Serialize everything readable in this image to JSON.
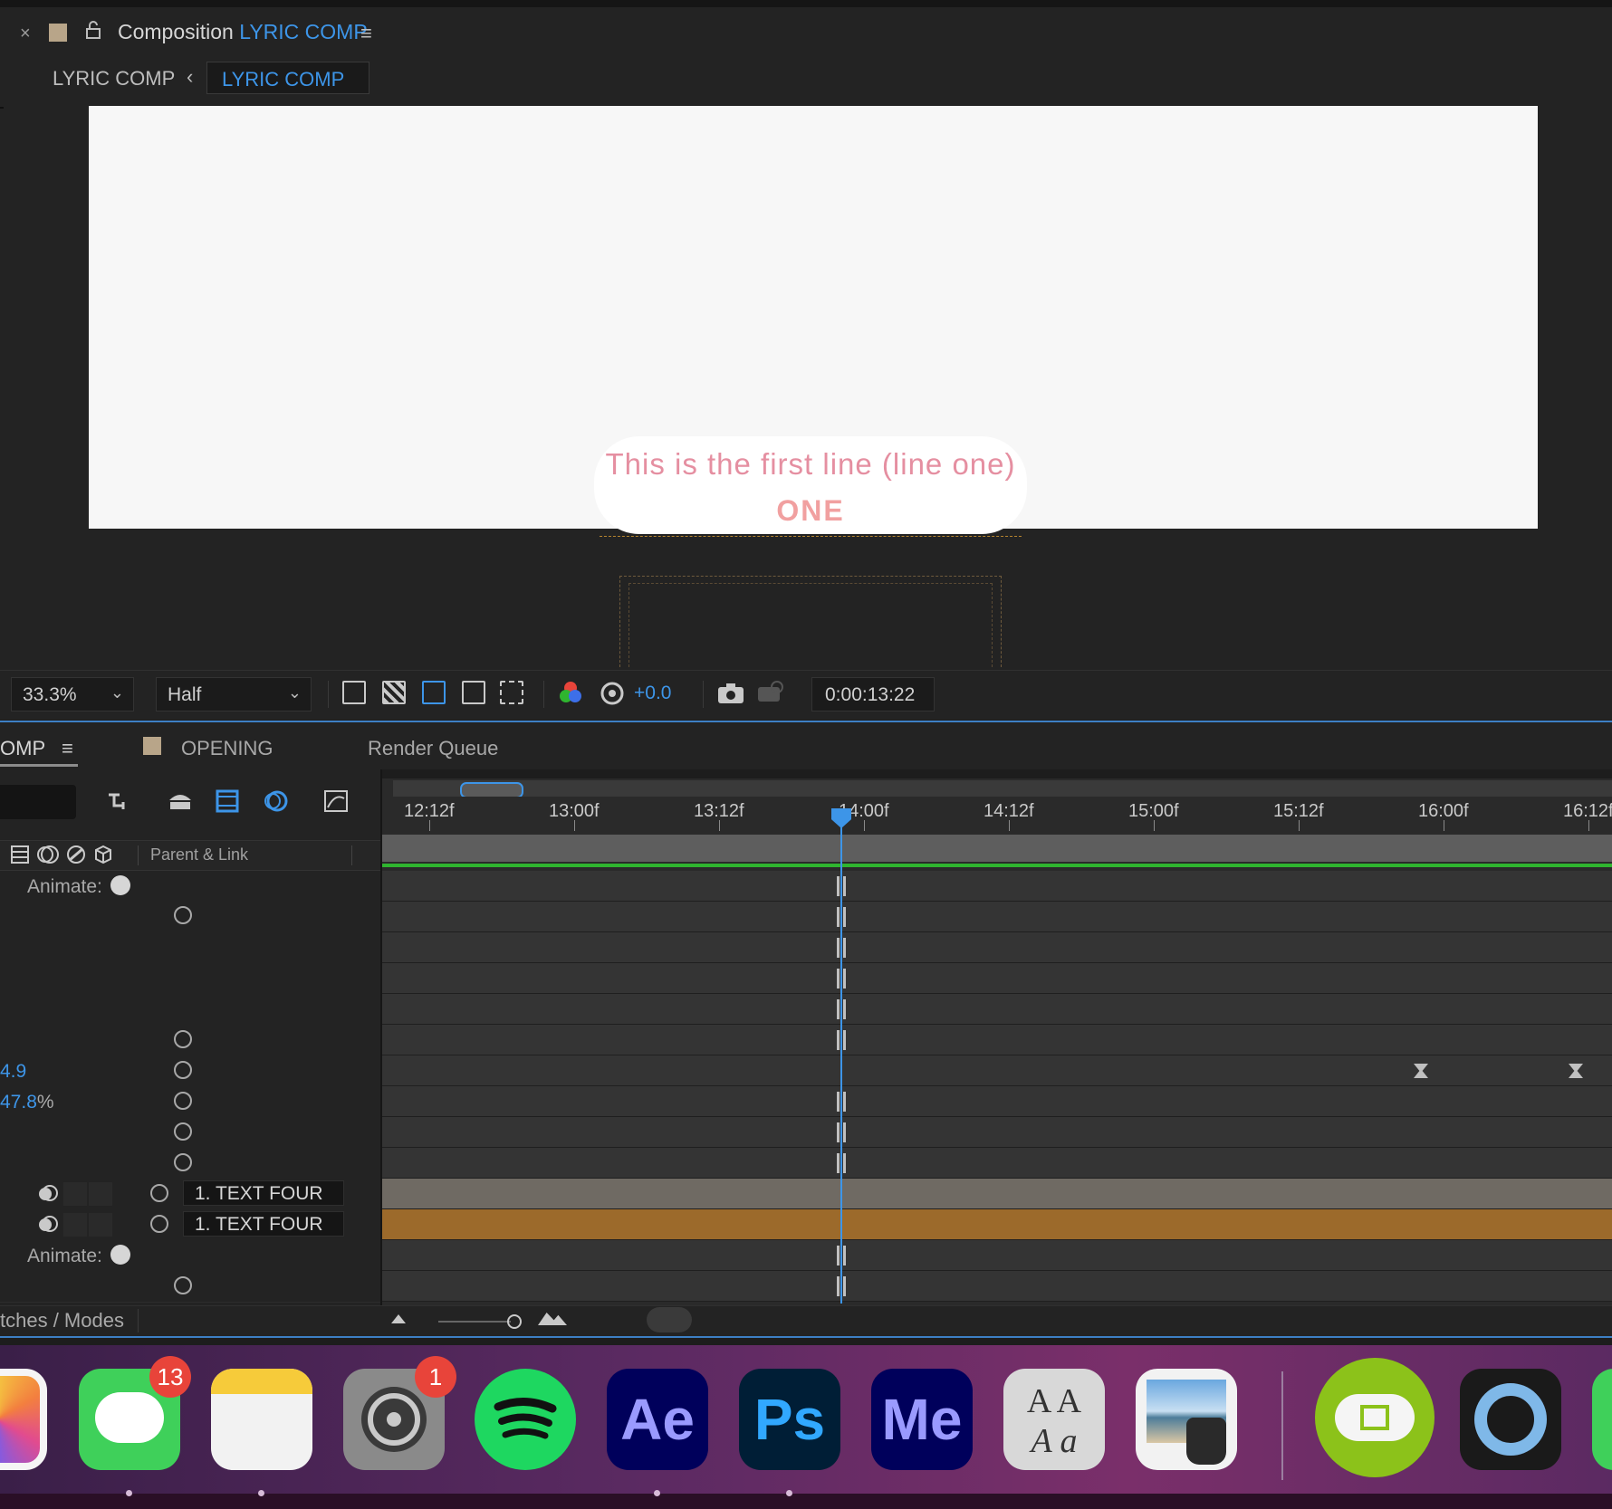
{
  "composition_panel": {
    "title_prefix": "Composition",
    "title_name": "LYRIC COMP",
    "breadcrumb_first": "LYRIC COMP",
    "breadcrumb_active": "LYRIC COMP",
    "lyric_line1": "This is the first line (line one)",
    "lyric_line2": "ONE"
  },
  "viewer_toolbar": {
    "zoom": "33.3%",
    "resolution": "Half",
    "exposure": "+0.0",
    "timecode": "0:00:13:22"
  },
  "timeline": {
    "tabs": {
      "active": "OMP",
      "opening": "OPENING",
      "render_queue": "Render Queue"
    },
    "parent_link_header": "Parent & Link",
    "ruler_labels": [
      "12:12f",
      "13:00f",
      "13:12f",
      "14:00f",
      "14:12f",
      "15:00f",
      "15:12f",
      "16:00f",
      "16:12f"
    ],
    "animate_label": "Animate:",
    "value_1": "4.9",
    "value_2": "47.8",
    "value_2_unit": "%",
    "parent_select_1": "1. TEXT FOUR",
    "parent_select_2": "1. TEXT FOUR",
    "switches_label": "tches / Modes"
  },
  "dock": {
    "messages_badge": "13",
    "settings_badge": "1",
    "ae_label": "Ae",
    "ps_label": "Ps",
    "me_label": "Me",
    "fontbook_top": "A A",
    "fontbook_bottom": "A a"
  },
  "colors": {
    "accent_blue": "#3d95e8",
    "work_area_green": "#2fb52f",
    "layer_orange": "#9c6a2b",
    "lyric_pink": "#e58fa1"
  }
}
